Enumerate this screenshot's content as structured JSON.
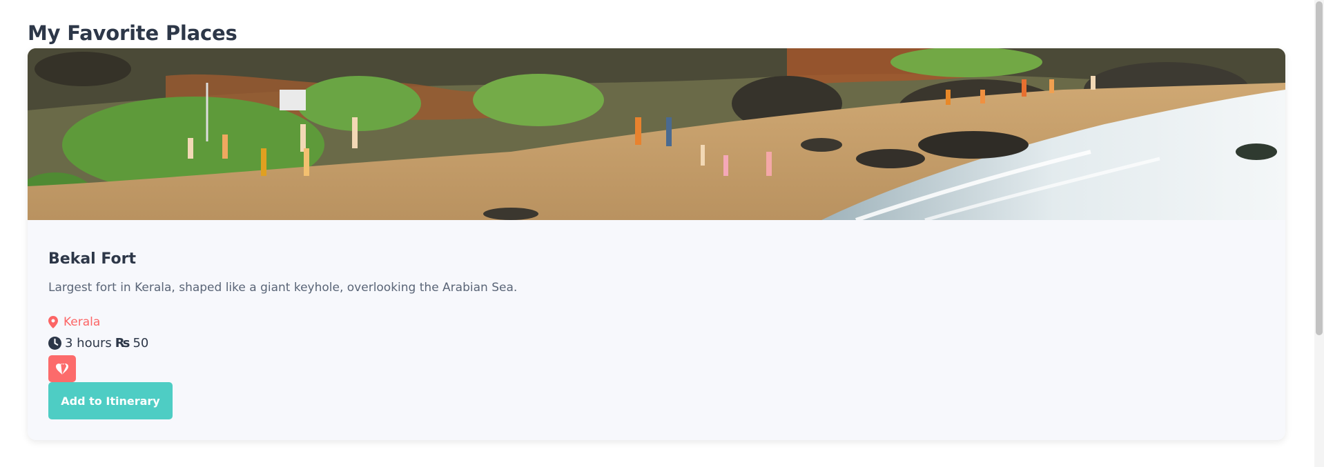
{
  "page": {
    "title": "My Favorite Places"
  },
  "place": {
    "name": "Bekal Fort",
    "description": "Largest fort in Kerala, shaped like a giant keyhole, overlooking the Arabian Sea.",
    "location": "Kerala",
    "duration": "3 hours",
    "currency_symbol": "₨",
    "price": "50",
    "image_alt": "Beach with rocks, green hills and people walking along the shore",
    "favorited": true,
    "add_button_label": "Add to Itinerary"
  },
  "icons": {
    "location": "map-pin-icon",
    "duration": "clock-icon",
    "favorite": "heart-icon"
  },
  "colors": {
    "accent": "#fc6b6b",
    "primary_button": "#4ecdc4",
    "heading": "#2d3748",
    "card_background": "#f7f8fc"
  }
}
